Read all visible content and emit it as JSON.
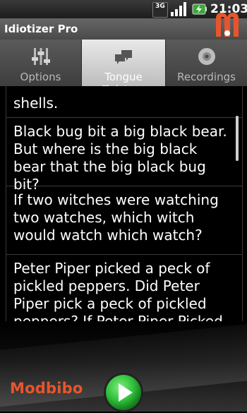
{
  "status_bar": {
    "network": "3G",
    "time": "21:03"
  },
  "app": {
    "title": "Idiotizer Pro"
  },
  "tabs": [
    {
      "label": "Options",
      "icon": "sliders-icon",
      "active": false
    },
    {
      "label": "Tongue Twisters",
      "icon": "speech-bubbles-icon",
      "active": true
    },
    {
      "label": "Recordings",
      "icon": "disc-icon",
      "active": false
    }
  ],
  "twisters": [
    {
      "text": "shells."
    },
    {
      "text": "Black bug bit a big black bear. But where is the big black bear that the big black bug bit?"
    },
    {
      "text": "If two witches were watching two watches, which witch would watch which watch?"
    },
    {
      "text": "Peter Piper picked a peck of pickled peppers. Did Peter Piper pick a peck of pickled peppers? If Peter Piper Picked"
    }
  ],
  "footer": {
    "brand": "Modbibo"
  },
  "colors": {
    "brand": "#e8552c",
    "play_green": "#2fbf3a"
  }
}
